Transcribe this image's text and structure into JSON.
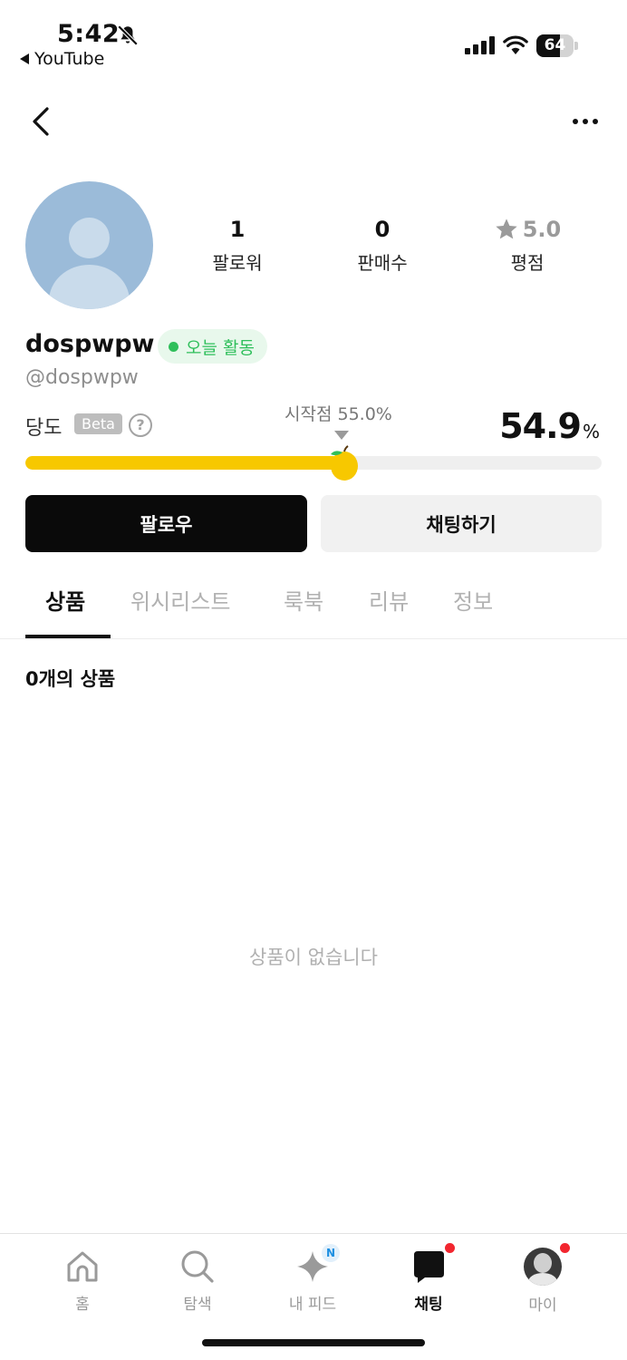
{
  "status_bar": {
    "time": "5:42",
    "back_app": "YouTube",
    "battery": "64",
    "battery_level": 0.64
  },
  "profile": {
    "stats": [
      {
        "value": "1",
        "label": "팔로워"
      },
      {
        "value": "0",
        "label": "판매수"
      },
      {
        "value": "5.0",
        "label": "평점"
      }
    ],
    "username": "dospwpw",
    "active_badge": "오늘 활동",
    "handle": "@dospwpw"
  },
  "dangdo": {
    "label": "당도",
    "beta": "Beta",
    "help": "?",
    "start_label": "시작점 55.0%",
    "start_value": 55.0,
    "score": "54.9",
    "score_value": 54.9,
    "unit": "%"
  },
  "buttons": {
    "follow": "팔로우",
    "chat": "채팅하기"
  },
  "tabs": [
    "상품",
    "위시리스트",
    "룩북",
    "리뷰",
    "정보"
  ],
  "products": {
    "count_prefix": "0",
    "count_suffix": "개의 상품",
    "empty": "상품이 없습니다"
  },
  "tabbar": [
    {
      "label": "홈",
      "icon": "home-icon"
    },
    {
      "label": "탐색",
      "icon": "search-icon"
    },
    {
      "label": "내 피드",
      "icon": "sparkle-icon",
      "badge": "N"
    },
    {
      "label": "채팅",
      "icon": "chat-icon"
    },
    {
      "label": "마이",
      "icon": "profile-avatar"
    }
  ],
  "colors": {
    "accent_yellow": "#f7c800",
    "active_green": "#2fbf5b",
    "notification_red": "#f2262f"
  }
}
